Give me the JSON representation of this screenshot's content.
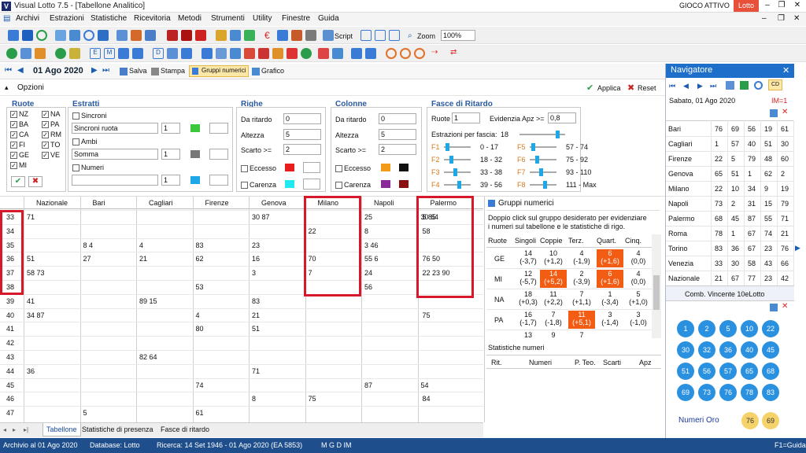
{
  "window": {
    "app_title": "Visual Lotto 7.5 - [Tabellone Analitico]",
    "gioco_attivo": "GIOCO ATTIVO",
    "gioco": "Lotto"
  },
  "menu": [
    "Archivi",
    "Estrazioni",
    "Statistiche",
    "Ricevitoria",
    "Metodi",
    "Strumenti",
    "Utility",
    "Finestre",
    "Guida"
  ],
  "toolbar": {
    "script": "Script",
    "zoom_label": "Zoom",
    "zoom_value": "100%"
  },
  "datebar": {
    "date": "01 Ago 2020",
    "salva": "Salva",
    "stampa": "Stampa",
    "gruppi": "Gruppi numerici",
    "grafico": "Grafico"
  },
  "opzioni": {
    "title": "Opzioni",
    "applica": "Applica",
    "reset": "Reset"
  },
  "ruote": {
    "title": "Ruote",
    "items": [
      "NZ",
      "BA",
      "CA",
      "FI",
      "GE",
      "MI",
      "NA",
      "PA",
      "RM",
      "TO",
      "VE"
    ]
  },
  "estratti": {
    "title": "Estratti",
    "sincroni": "Sincroni",
    "sincroni_sel": "Sincroni ruota",
    "ambi": "Ambi",
    "ambi_sel": "Somma",
    "numeri": "Numeri",
    "v1": "1",
    "v2": "1",
    "v3": "1"
  },
  "righe": {
    "title": "Righe",
    "da_ritardo": "Da ritardo",
    "da_ritardo_v": "0",
    "altezza": "Altezza",
    "altezza_v": "5",
    "scarto": "Scarto >=",
    "scarto_v": "2",
    "eccesso": "Eccesso",
    "carenza": "Carenza"
  },
  "colonne": {
    "title": "Colonne",
    "da_ritardo": "Da ritardo",
    "da_ritardo_v": "0",
    "altezza": "Altezza",
    "altezza_v": "5",
    "scarto": "Scarto >=",
    "scarto_v": "2",
    "eccesso": "Eccesso",
    "carenza": "Carenza"
  },
  "fasce": {
    "title": "Fasce di Ritardo",
    "ruote_label": "Ruote",
    "ruote_v": "1",
    "evid_label": "Evidenzia Apz >=",
    "evid_v": "0,8",
    "per_fascia_label": "Estrazioni per fascia:",
    "per_fascia_v": "18",
    "items": [
      {
        "f": "F1",
        "r": "0 - 17"
      },
      {
        "f": "F2",
        "r": "18 - 32"
      },
      {
        "f": "F3",
        "r": "33 - 38"
      },
      {
        "f": "F4",
        "r": "39 - 56"
      },
      {
        "f": "F5",
        "r": "57 - 74"
      },
      {
        "f": "F6",
        "r": "75 - 92"
      },
      {
        "f": "F7",
        "r": "93 - 110"
      },
      {
        "f": "F8",
        "r": "111 - Max"
      }
    ]
  },
  "grid": {
    "columns": [
      "Nazionale",
      "Bari",
      "Cagliari",
      "Firenze",
      "Genova",
      "Milano",
      "Napoli",
      "Palermo"
    ],
    "rows": [
      "33",
      "34",
      "35",
      "36",
      "37",
      "38",
      "39",
      "40",
      "41",
      "42",
      "43",
      "44",
      "45",
      "46",
      "47"
    ],
    "cells": [
      [
        "71",
        "",
        "",
        "",
        "30 87",
        "",
        "25",
        "30 64",
        "5 85"
      ],
      [
        "",
        "",
        "",
        "",
        "",
        "22",
        "8",
        "",
        "58"
      ],
      [
        "",
        "8 4",
        "4",
        "83",
        "23",
        "",
        "3 46",
        "",
        ""
      ],
      [
        "51",
        "27",
        "21",
        "62",
        "16",
        "70",
        "55 6",
        "",
        "76 50"
      ],
      [
        "58 73",
        "",
        "",
        "",
        "3",
        "7",
        "24",
        "",
        "22 23 90"
      ],
      [
        "",
        "",
        "",
        "53",
        "",
        "",
        "56",
        "",
        ""
      ],
      [
        "41",
        "",
        "89 15",
        "",
        "83",
        "",
        "",
        "",
        ""
      ],
      [
        "34 87",
        "",
        "",
        "4",
        "21",
        "",
        "",
        "",
        "75"
      ],
      [
        "",
        "",
        "",
        "80",
        "51",
        "",
        "",
        "",
        ""
      ],
      [
        "",
        "",
        "",
        "",
        "",
        "",
        "",
        "",
        ""
      ],
      [
        "",
        "",
        "82 64",
        "",
        "",
        "",
        "",
        "",
        ""
      ],
      [
        "36",
        "",
        "",
        "",
        "71",
        "",
        "",
        "",
        ""
      ],
      [
        "",
        "",
        "",
        "74",
        "",
        "",
        "87",
        "54",
        ""
      ],
      [
        "",
        "",
        "",
        "",
        "8",
        "75",
        "",
        "",
        "84"
      ],
      [
        "",
        "5",
        "",
        "61",
        "",
        "",
        "",
        "",
        ""
      ]
    ]
  },
  "tabs": [
    "Tabellone",
    "Statistiche di presenza",
    "Fasce di ritardo"
  ],
  "gruppi": {
    "title": "Gruppi numerici",
    "desc": "Doppio click sul gruppo desiderato per evidenziare i numeri sul tabellone e le statistiche di rigo.",
    "headers": [
      "Ruote",
      "Singoli",
      "Coppie",
      "Terz.",
      "Quart.",
      "Cinq."
    ],
    "rows": [
      {
        "ruota": "GE",
        "v": [
          "14",
          "10",
          "4",
          "6",
          "4"
        ],
        "s": [
          "(-3,7)",
          "(+1,2)",
          "(-1,9)",
          "(+1,6)",
          "(0,0)"
        ]
      },
      {
        "ruota": "MI",
        "v": [
          "12",
          "14",
          "2",
          "6",
          "4"
        ],
        "s": [
          "(-5,7)",
          "(+5,2)",
          "(-3,9)",
          "(+1,6)",
          "(0,0)"
        ]
      },
      {
        "ruota": "NA",
        "v": [
          "18",
          "11",
          "7",
          "1",
          "5"
        ],
        "s": [
          "(+0,3)",
          "(+2,2)",
          "(+1,1)",
          "(-3,4)",
          "(+1,0)"
        ]
      },
      {
        "ruota": "PA",
        "v": [
          "16",
          "7",
          "11",
          "3",
          "3"
        ],
        "s": [
          "(-1,7)",
          "(-1,8)",
          "(+5,1)",
          "(-1,4)",
          "(-1,0)"
        ]
      },
      {
        "ruota": "",
        "v": [
          "13",
          "9",
          "7",
          "",
          ""
        ],
        "s": [
          "",
          "",
          "",
          "",
          ""
        ]
      }
    ],
    "stat_title": "Statistiche numeri",
    "stat_headers": [
      "Rit.",
      "Numeri",
      "P. Teo.",
      "Scarti",
      "Apz"
    ]
  },
  "navigator": {
    "title": "Navigatore",
    "date": "Sabato, 01 Ago 2020",
    "im": "IM=1",
    "rows": [
      {
        "r": "Bari",
        "n": [
          "76",
          "69",
          "56",
          "19",
          "61"
        ]
      },
      {
        "r": "Cagliari",
        "n": [
          "1",
          "57",
          "40",
          "51",
          "30"
        ]
      },
      {
        "r": "Firenze",
        "n": [
          "22",
          "5",
          "79",
          "48",
          "60"
        ]
      },
      {
        "r": "Genova",
        "n": [
          "65",
          "51",
          "1",
          "62",
          "2"
        ]
      },
      {
        "r": "Milano",
        "n": [
          "22",
          "10",
          "34",
          "9",
          "19"
        ]
      },
      {
        "r": "Napoli",
        "n": [
          "73",
          "2",
          "31",
          "15",
          "79"
        ]
      },
      {
        "r": "Palermo",
        "n": [
          "68",
          "45",
          "87",
          "55",
          "71"
        ]
      },
      {
        "r": "Roma",
        "n": [
          "78",
          "1",
          "67",
          "74",
          "21"
        ]
      },
      {
        "r": "Torino",
        "n": [
          "83",
          "36",
          "67",
          "23",
          "76"
        ]
      },
      {
        "r": "Venezia",
        "n": [
          "33",
          "30",
          "58",
          "43",
          "66"
        ]
      },
      {
        "r": "Nazionale",
        "n": [
          "21",
          "67",
          "77",
          "23",
          "42"
        ]
      }
    ],
    "comb_title": "Comb. Vincente 10eLotto",
    "balls": [
      "1",
      "2",
      "5",
      "10",
      "22",
      "30",
      "32",
      "36",
      "40",
      "45",
      "51",
      "56",
      "57",
      "65",
      "68",
      "69",
      "73",
      "76",
      "78",
      "83"
    ],
    "oro_label": "Numeri Oro",
    "oro": [
      "76",
      "69"
    ]
  },
  "status": {
    "archivio": "Archivio al 01 Ago 2020",
    "database": "Database: Lotto",
    "ricerca": "Ricerca:  14 Set 1946 - 01 Ago 2020 (EA 5853)",
    "flags": "M   G   D   IM",
    "help": "F1=Guida"
  }
}
